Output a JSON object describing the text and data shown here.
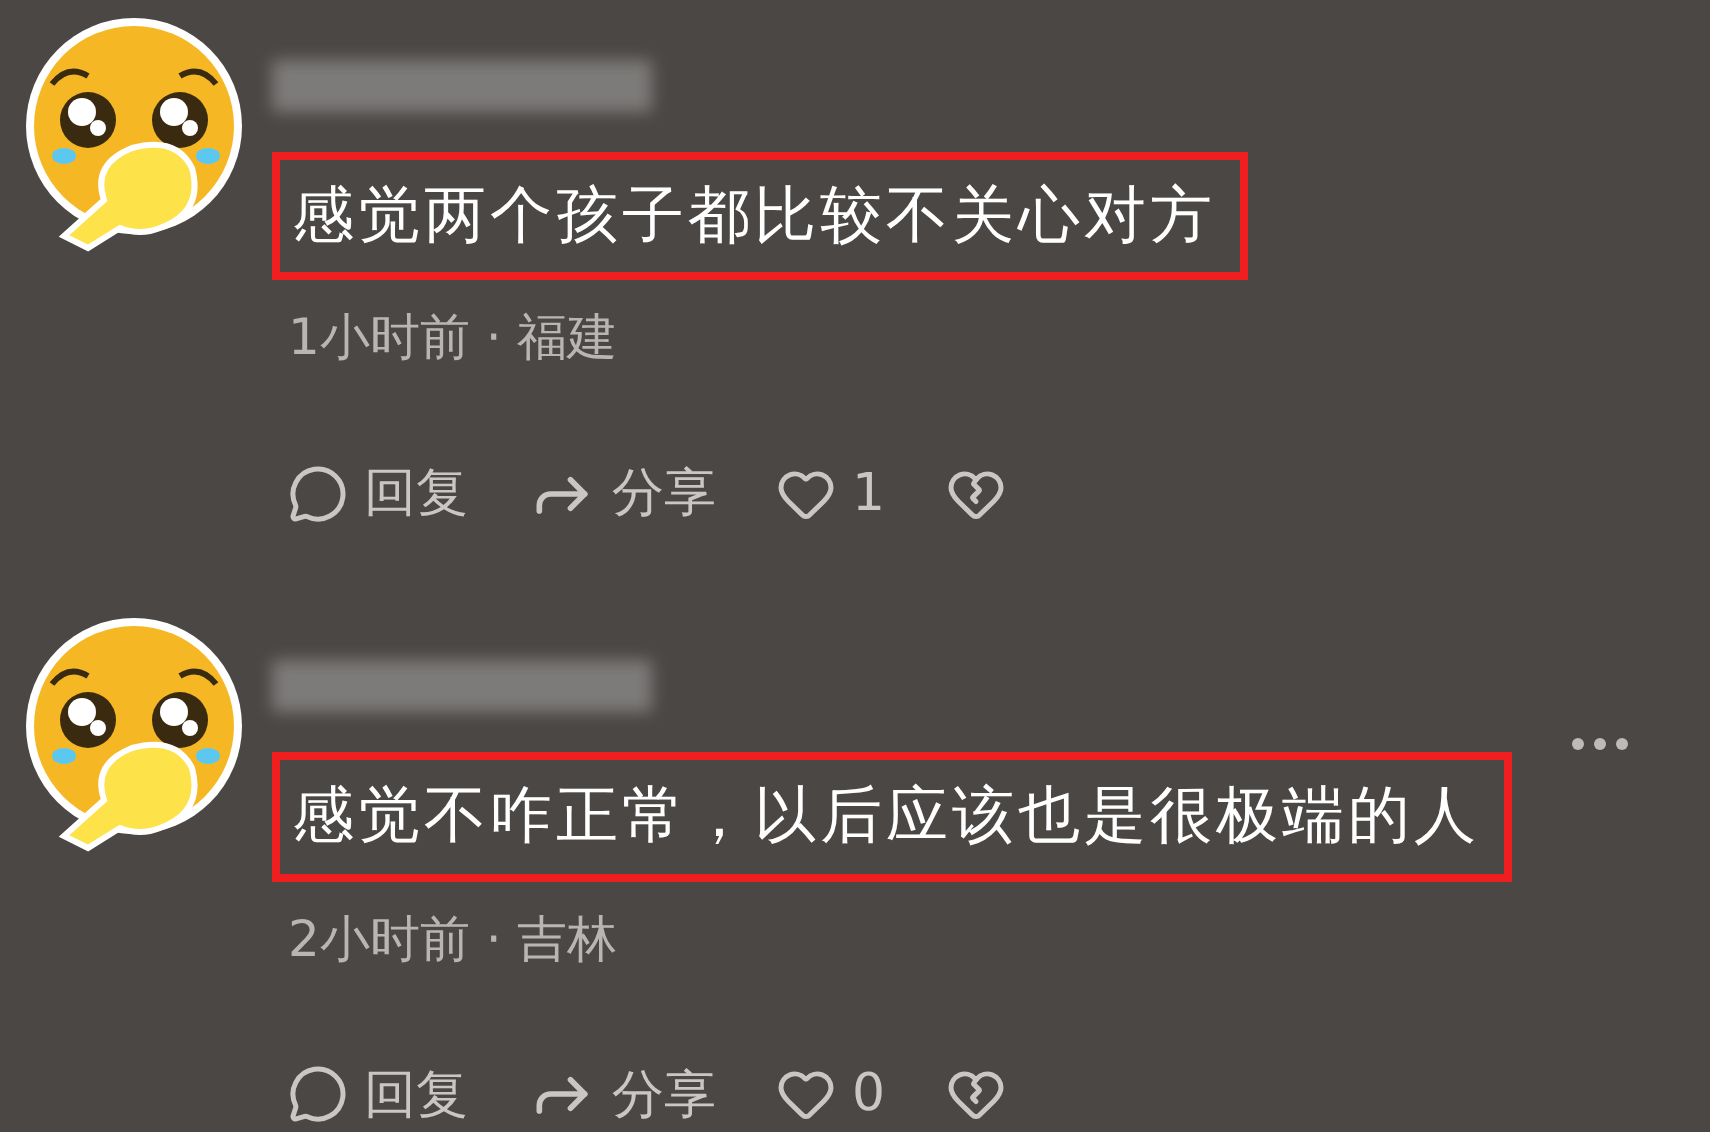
{
  "comments": [
    {
      "text": "感觉两个孩子都比较不关心对方",
      "highlighted": true,
      "meta": "1小时前 · 福建",
      "has_more": false,
      "actions": [
        {
          "kind": "reply",
          "label": "回复"
        },
        {
          "kind": "share",
          "label": "分享"
        },
        {
          "kind": "like",
          "label": "1"
        },
        {
          "kind": "dislike"
        }
      ]
    },
    {
      "text": "感觉不咋正常，以后应该也是很极端的人",
      "highlighted": true,
      "meta": "2小时前 · 吉林",
      "has_more": true,
      "actions": [
        {
          "kind": "reply",
          "label": "回复"
        },
        {
          "kind": "share",
          "label": "分享"
        },
        {
          "kind": "like",
          "label": "0"
        },
        {
          "kind": "dislike"
        }
      ]
    }
  ]
}
